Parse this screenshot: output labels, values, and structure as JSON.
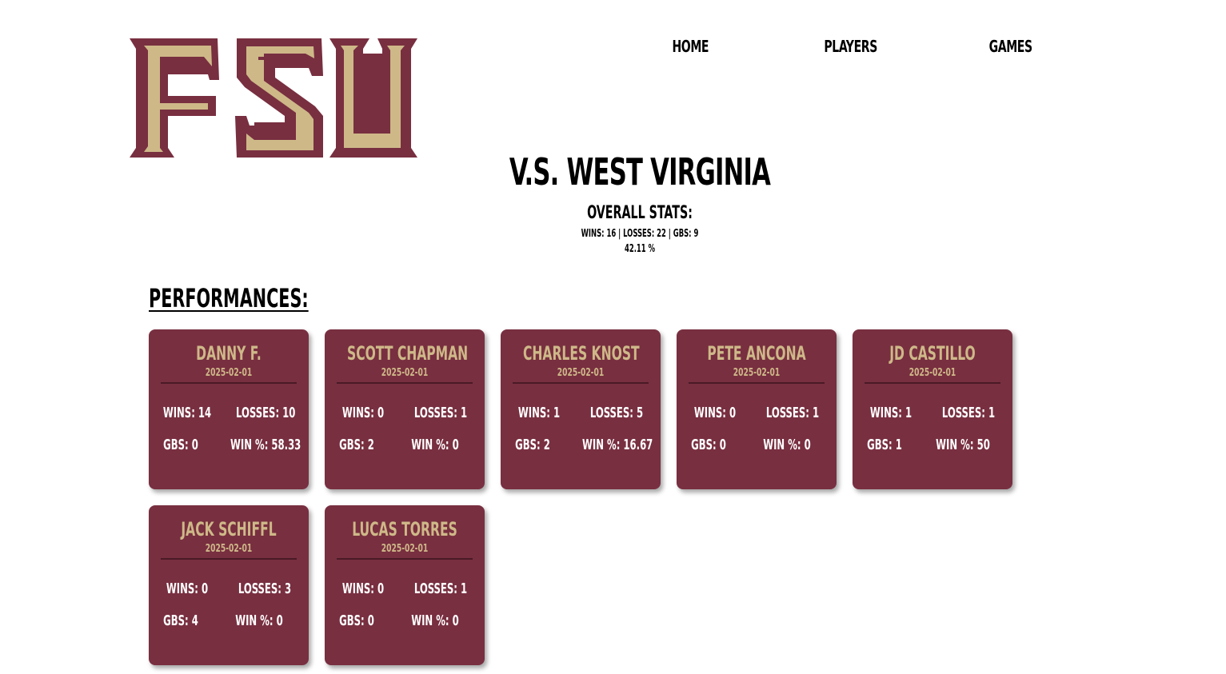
{
  "logo": {
    "text": "FSU",
    "primary_color": "#782f40",
    "accent_color": "#ceb888"
  },
  "nav": {
    "home": "HOME",
    "players": "PLAYERS",
    "games": "GAMES"
  },
  "game": {
    "title": "V.S. WEST VIRGINIA",
    "overall_title": "OVERALL STATS:",
    "overall_line": "WINS: 16 | LOSSES: 22 | GBS: 9",
    "overall_pct": "42.11 %"
  },
  "performances": {
    "heading": "PERFORMANCES:",
    "cards": [
      {
        "name": "DANNY F.",
        "date": "2025-02-01",
        "wins": "WINS: 14",
        "losses": "LOSSES: 10",
        "gbs": "GBS: 0",
        "win_pct": "WIN %: 58.33"
      },
      {
        "name": "SCOTT CHAPMAN",
        "date": "2025-02-01",
        "wins": "WINS: 0",
        "losses": "LOSSES: 1",
        "gbs": "GBS: 2",
        "win_pct": "WIN %: 0"
      },
      {
        "name": "CHARLES KNOST",
        "date": "2025-02-01",
        "wins": "WINS: 1",
        "losses": "LOSSES: 5",
        "gbs": "GBS: 2",
        "win_pct": "WIN %: 16.67"
      },
      {
        "name": "PETE ANCONA",
        "date": "2025-02-01",
        "wins": "WINS: 0",
        "losses": "LOSSES: 1",
        "gbs": "GBS: 0",
        "win_pct": "WIN %: 0"
      },
      {
        "name": "JD CASTILLO",
        "date": "2025-02-01",
        "wins": "WINS: 1",
        "losses": "LOSSES: 1",
        "gbs": "GBS: 1",
        "win_pct": "WIN %: 50"
      },
      {
        "name": "JACK SCHIFFL",
        "date": "2025-02-01",
        "wins": "WINS: 0",
        "losses": "LOSSES: 3",
        "gbs": "GBS: 4",
        "win_pct": "WIN %: 0"
      },
      {
        "name": "LUCAS TORRES",
        "date": "2025-02-01",
        "wins": "WINS: 0",
        "losses": "LOSSES: 1",
        "gbs": "GBS: 0",
        "win_pct": "WIN %: 0"
      }
    ]
  }
}
